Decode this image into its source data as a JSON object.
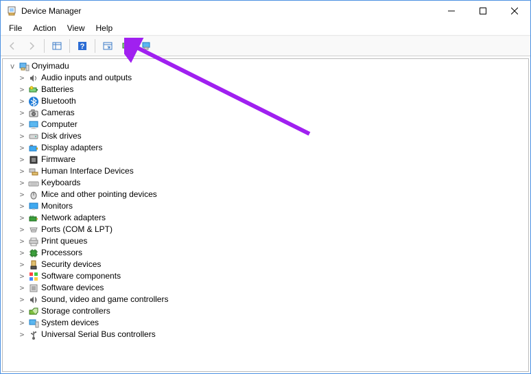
{
  "window": {
    "title": "Device Manager"
  },
  "menu": {
    "file": "File",
    "action": "Action",
    "view": "View",
    "help": "Help"
  },
  "tree": {
    "root": "Onyimadu",
    "items": [
      {
        "label": "Audio inputs and outputs"
      },
      {
        "label": "Batteries"
      },
      {
        "label": "Bluetooth"
      },
      {
        "label": "Cameras"
      },
      {
        "label": "Computer"
      },
      {
        "label": "Disk drives"
      },
      {
        "label": "Display adapters"
      },
      {
        "label": "Firmware"
      },
      {
        "label": "Human Interface Devices"
      },
      {
        "label": "Keyboards"
      },
      {
        "label": "Mice and other pointing devices"
      },
      {
        "label": "Monitors"
      },
      {
        "label": "Network adapters"
      },
      {
        "label": "Ports (COM & LPT)"
      },
      {
        "label": "Print queues"
      },
      {
        "label": "Processors"
      },
      {
        "label": "Security devices"
      },
      {
        "label": "Software components"
      },
      {
        "label": "Software devices"
      },
      {
        "label": "Sound, video and game controllers"
      },
      {
        "label": "Storage controllers"
      },
      {
        "label": "System devices"
      },
      {
        "label": "Universal Serial Bus controllers"
      }
    ]
  },
  "colors": {
    "accent": "#a020f0"
  }
}
